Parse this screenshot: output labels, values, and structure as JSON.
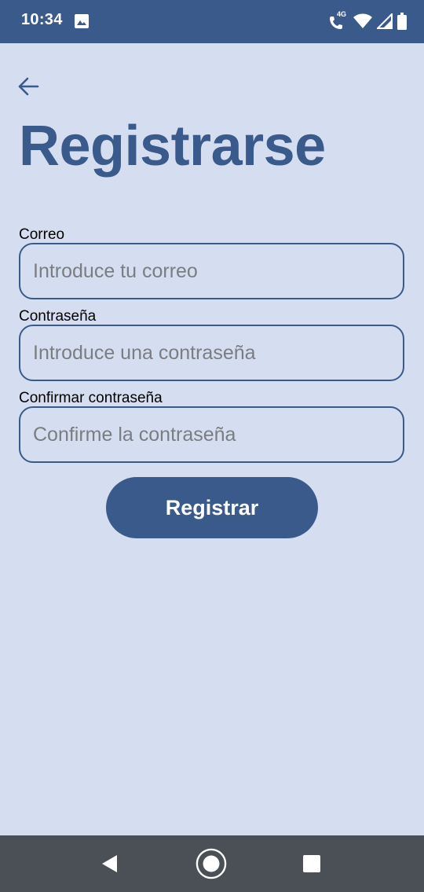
{
  "status_bar": {
    "time": "10:34",
    "network_label": "4G",
    "icons": [
      "image-icon",
      "wifi-call-icon",
      "wifi-icon",
      "signal-icon",
      "battery-icon"
    ]
  },
  "header": {
    "back_icon": "arrow-left-icon",
    "title": "Registrarse"
  },
  "form": {
    "email": {
      "label": "Correo",
      "placeholder": "Introduce tu correo",
      "value": ""
    },
    "password": {
      "label": "Contraseña",
      "placeholder": "Introduce una contraseña",
      "value": ""
    },
    "confirm_password": {
      "label": "Confirmar contraseña",
      "placeholder": "Confirme la contraseña",
      "value": ""
    },
    "submit_label": "Registrar"
  },
  "nav_bar": {
    "icons": [
      "back-triangle-icon",
      "home-circle-icon",
      "recents-square-icon"
    ]
  },
  "colors": {
    "primary": "#3a5a8c",
    "background": "#d5def0",
    "nav_bar": "#4a5055"
  }
}
